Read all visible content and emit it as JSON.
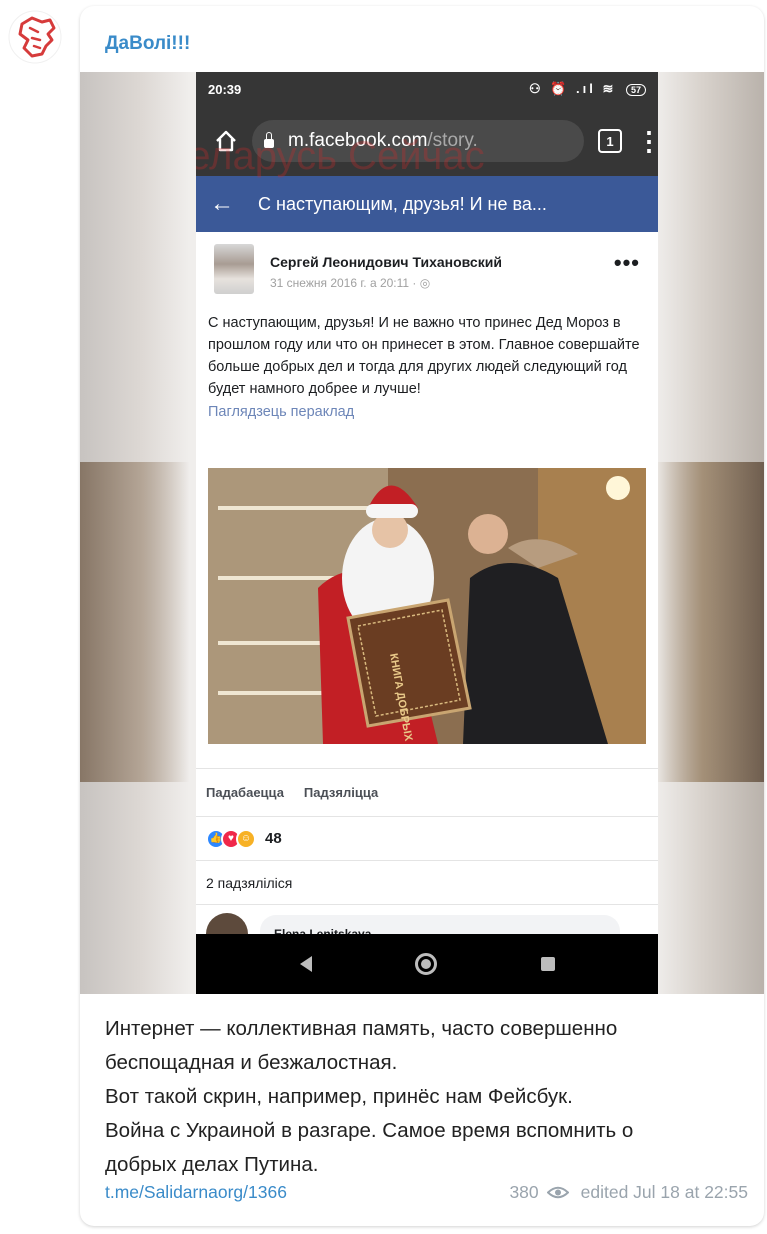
{
  "channel": {
    "name": "ДаВолі!!!"
  },
  "phone": {
    "status_time": "20:39",
    "status_icons": "⚇ ⏰ .ıl ≋",
    "battery": "57",
    "url_host": "m.facebook.com",
    "url_path": "/story.",
    "tabs_count": "1",
    "watermark": "Беларусь Сейчас",
    "fb_header_title": "С наступающим, друзья! И не ва...",
    "post": {
      "author": "Сергей Леонидович Тихановский",
      "date": "31 снежня 2016 г. а 20:11 · ◎",
      "text": "С наступающим, друзья! И не важно что принес Дед Мороз в прошлом году или что он принесет в этом. Главное совершайте больше добрых дел и тогда для других людей следующий год будет намного добрее и лучше!",
      "translate_link": "Паглядзець пераклад",
      "book_title": "КНИГА ДОБРЫХ ДЕЛ",
      "like_label": "Падабаецца",
      "share_label": "Падзяліцца",
      "reactions_count": "48",
      "shares_text": "2 падзяліліся",
      "comment_author": "Elena Lenitskaya"
    }
  },
  "caption_lines": [
    "Интернет — коллективная память, часто совершенно",
    "беспощадная и безжалостная.",
    "Вот такой скрин, например, принёс нам Фейсбук.",
    "Война с Украиной в разгаре. Самое время вспомнить о",
    "добрых делах Путина."
  ],
  "footer": {
    "link": "t.me/Salidarnaorg/1366",
    "views": "380",
    "edited": "edited  Jul 18 at 22:55"
  },
  "colors": {
    "accent": "#3a8bc9",
    "facebook_blue": "#3b5998",
    "logo_red": "#d63b3b"
  }
}
